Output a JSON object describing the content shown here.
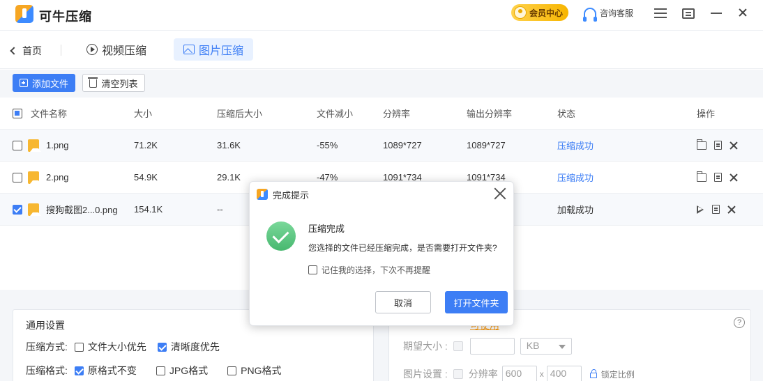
{
  "app": {
    "name": "可牛压缩"
  },
  "titlebar": {
    "vip_label": "会员中心",
    "support_label": "咨询客服"
  },
  "nav": {
    "back_label": "首页",
    "tabs": [
      {
        "label": "视频压缩",
        "active": false
      },
      {
        "label": "图片压缩",
        "active": true
      }
    ]
  },
  "toolbar": {
    "add_label": "添加文件",
    "clear_label": "清空列表"
  },
  "table": {
    "headers": [
      "文件名称",
      "大小",
      "压缩后大小",
      "文件减小",
      "分辨率",
      "输出分辨率",
      "状态",
      "操作"
    ],
    "rows": [
      {
        "checked": false,
        "name": "1.png",
        "size": "71.2K",
        "compressed": "31.6K",
        "reduced": "-55%",
        "resolution": "1089*727",
        "output": "1089*727",
        "status": "压缩成功",
        "status_link": true
      },
      {
        "checked": false,
        "name": "2.png",
        "size": "54.9K",
        "compressed": "29.1K",
        "reduced": "-47%",
        "resolution": "1091*734",
        "output": "1091*734",
        "status": "压缩成功",
        "status_link": true
      },
      {
        "checked": true,
        "name": "搜狗截图2...0.png",
        "size": "154.1K",
        "compressed": "--",
        "reduced": "",
        "resolution": "",
        "output": "",
        "status": "加载成功",
        "status_link": false
      }
    ]
  },
  "settings": {
    "title": "通用设置",
    "mode_label": "压缩方式:",
    "mode_options": [
      "文件大小优先",
      "清晰度优先"
    ],
    "format_label": "压缩格式:",
    "format_options": [
      "原格式不变",
      "JPG格式",
      "PNG格式"
    ],
    "right": {
      "link_text": "可使用",
      "size_label": "期望大小 :",
      "size_unit": "KB",
      "image_label": "图片设置 :",
      "resolution_label": "分辨率",
      "width": "600",
      "times": "x",
      "height": "400",
      "lock_label": "锁定比例"
    }
  },
  "modal": {
    "title": "完成提示",
    "heading": "压缩完成",
    "message": "您选择的文件已经压缩完成，是否需要打开文件夹?",
    "remember_label": "记住我的选择，下次不再提醒",
    "cancel_label": "取消",
    "open_label": "打开文件夹"
  },
  "colors": {
    "accent": "#3d7ef5",
    "vip": "#f7b500",
    "success": "#48b86f"
  }
}
